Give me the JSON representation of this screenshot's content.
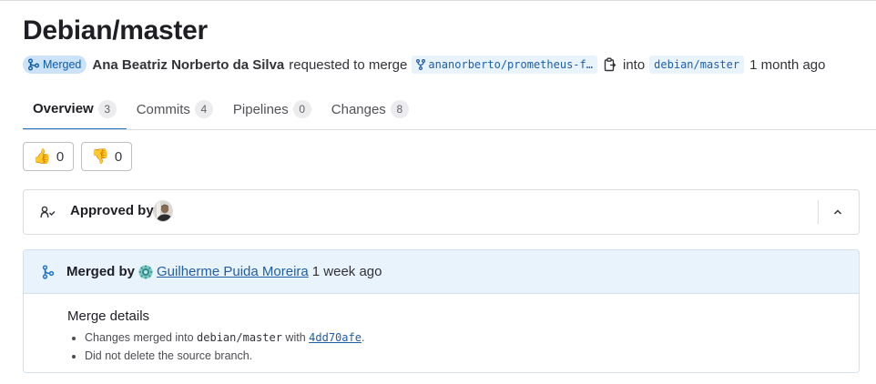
{
  "title": "Debian/master",
  "meta": {
    "status_badge": "Merged",
    "author": "Ana Beatriz Norberto da Silva",
    "action_text": "requested to merge",
    "source_branch": "ananorberto/prometheus-f…",
    "into_text": "into",
    "target_branch": "debian/master",
    "time": "1 month ago"
  },
  "tabs": [
    {
      "label": "Overview",
      "count": "3"
    },
    {
      "label": "Commits",
      "count": "4"
    },
    {
      "label": "Pipelines",
      "count": "0"
    },
    {
      "label": "Changes",
      "count": "8"
    }
  ],
  "reactions": {
    "thumbs_up": {
      "emoji": "👍",
      "count": "0"
    },
    "thumbs_down": {
      "emoji": "👎",
      "count": "0"
    }
  },
  "approval": {
    "label": "Approved by"
  },
  "merge": {
    "merged_by_label": "Merged by",
    "user": "Guilherme Puida Moreira",
    "time": "1 week ago",
    "details_title": "Merge details",
    "item1_prefix": "Changes merged into",
    "item1_branch": "debian/master",
    "item1_with": "with",
    "item1_commit": "4dd70afe",
    "item1_suffix": ".",
    "item2": "Did not delete the source branch."
  },
  "colors": {
    "accent": "#1f75cb",
    "badge_bg": "#cbe2f9",
    "badge_text": "#0b5cad",
    "merge_header_bg": "#e9f3fc",
    "link": "#1f5ea8"
  },
  "icons": {
    "merged": "merge-icon",
    "branch": "branch-fork-icon",
    "copy": "clipboard-copy-icon",
    "approval": "approval-user-check-icon",
    "collapse": "chevron-up-icon"
  }
}
